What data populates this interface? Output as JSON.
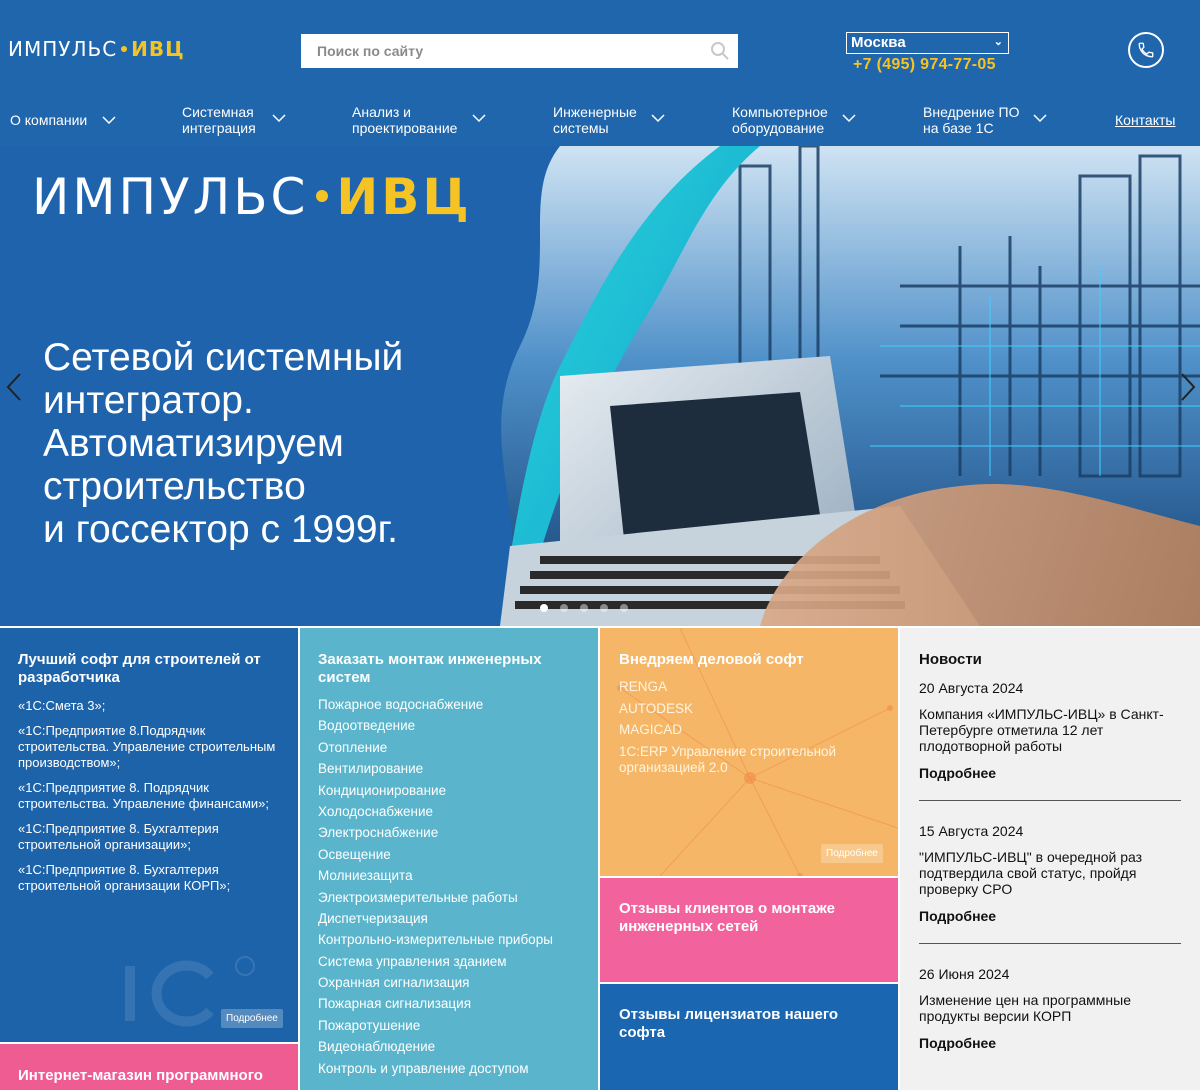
{
  "header": {
    "logo_main": "ИМПУЛЬС",
    "logo_accent": "ИВЦ",
    "search_placeholder": "Поиск по сайту",
    "city": "Москва",
    "phone": "+7 (495) 974-77-05"
  },
  "nav": {
    "items": [
      {
        "line1": "О компании",
        "line2": ""
      },
      {
        "line1": "Системная",
        "line2": "интеграция"
      },
      {
        "line1": "Анализ и",
        "line2": "проектирование"
      },
      {
        "line1": "Инженерные",
        "line2": "системы"
      },
      {
        "line1": "Компьютерное",
        "line2": "оборудование"
      },
      {
        "line1": "Внедрение ПО",
        "line2": "на базе 1С"
      }
    ],
    "contacts": "Контакты"
  },
  "hero": {
    "logo_main": "ИМПУЛЬС",
    "logo_accent": "ИВЦ",
    "lines": [
      "Сетевой системный",
      "интегратор.",
      "Автоматизируем",
      "строительство",
      "и госсектор с 1999г."
    ]
  },
  "tiles": {
    "software": {
      "title": "Лучший софт для строителей от разработчика",
      "items": [
        "«1С:Смета 3»;",
        "«1С:Предприятие 8.Подрядчик строительства. Управление строительным производством»;",
        "«1С:Предприятие 8. Подрядчик строительства. Управление финансами»;",
        "«1С:Предприятие 8. Бухгалтерия строительной организации»;",
        "«1С:Предприятие 8. Бухгалтерия строительной организации КОРП»;"
      ],
      "more": "Подробнее"
    },
    "engineering": {
      "title": "Заказать монтаж инженерных систем",
      "items": [
        "Пожарное водоснабжение",
        "Водоотведение",
        "Отопление",
        "Вентилирование",
        "Кондиционирование",
        "Холодоснабжение",
        "Электроснабжение",
        "Освещение",
        "Молниезащита",
        "Электроизмерительные работы",
        "Диспетчеризация",
        "Контрольно-измерительные приборы",
        "Система управления зданием",
        "Охранная сигнализация",
        "Пожарная сигнализация",
        "Пожаротушение",
        "Видеонаблюдение",
        "Контроль и управление доступом"
      ]
    },
    "business": {
      "title": "Внедряем деловой софт",
      "items": [
        "RENGA",
        "AUTODESK",
        "MAGICAD",
        "1C:ERP Управление строительной организацией 2.0"
      ],
      "more": "Подробнее"
    },
    "reviews_install": {
      "title": "Отзывы клиентов о монтаже инженерных сетей"
    },
    "reviews_license": {
      "title": "Отзывы лицензиатов нашего софта"
    },
    "shop": {
      "title": "Интернет-магазин программного"
    }
  },
  "news": {
    "title": "Новости",
    "items": [
      {
        "date": "20 Августа 2024",
        "text": "Компания «ИМПУЛЬС-ИВЦ» в Санкт-Петербурге отметила 12 лет плодотворной работы",
        "more": "Подробнее"
      },
      {
        "date": "15 Августа 2024",
        "text": "\"ИМПУЛЬС-ИВЦ\" в очередной раз подтвердила свой статус, пройдя проверку СРО",
        "more": "Подробнее"
      },
      {
        "date": "26 Июня 2024",
        "text": "Изменение цен на программные продукты версии КОРП",
        "more": "Подробнее"
      }
    ]
  },
  "colors": {
    "brand_blue": "#1f66ad",
    "accent_yellow": "#f6c324",
    "teal": "#5ab5cc",
    "orange": "#f5b767",
    "pink": "#f2639d"
  }
}
